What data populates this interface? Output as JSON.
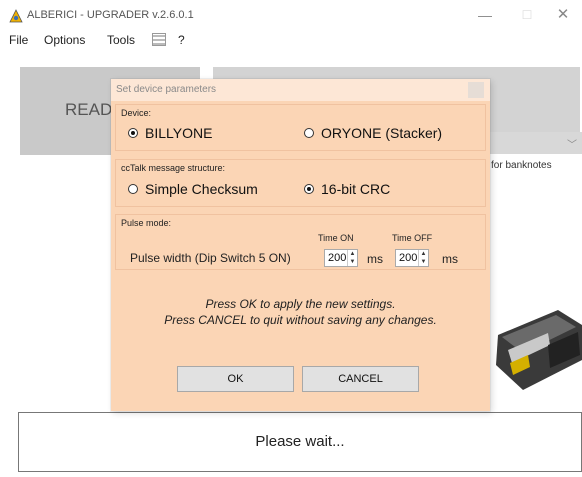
{
  "window": {
    "title": "ALBERICI - UPGRADER v.2.6.0.1",
    "minimize": "—",
    "maximize": "☐",
    "close": "✕"
  },
  "menu": {
    "items": [
      "File",
      "Options",
      "Tools",
      "?"
    ]
  },
  "background": {
    "read_button": "READ",
    "banknotes_text": "for banknotes",
    "status": "Please wait..."
  },
  "dialog": {
    "title": "Set device parameters",
    "device": {
      "label": "Device:",
      "options": [
        {
          "label": "BILLYONE",
          "selected": true
        },
        {
          "label": "ORYONE (Stacker)",
          "selected": false
        }
      ]
    },
    "cctalk": {
      "label": "ccTalk message structure:",
      "options": [
        {
          "label": "Simple Checksum",
          "selected": false
        },
        {
          "label": "16-bit CRC",
          "selected": true
        }
      ]
    },
    "pulse": {
      "label": "Pulse mode:",
      "width_label": "Pulse width (Dip Switch 5 ON)",
      "time_on_label": "Time ON",
      "time_off_label": "Time OFF",
      "time_on_value": "200",
      "time_off_value": "200",
      "unit": "ms"
    },
    "info_line1": "Press OK to apply the new settings.",
    "info_line2": "Press CANCEL to quit without saving any changes.",
    "ok_label": "OK",
    "cancel_label": "CANCEL"
  }
}
